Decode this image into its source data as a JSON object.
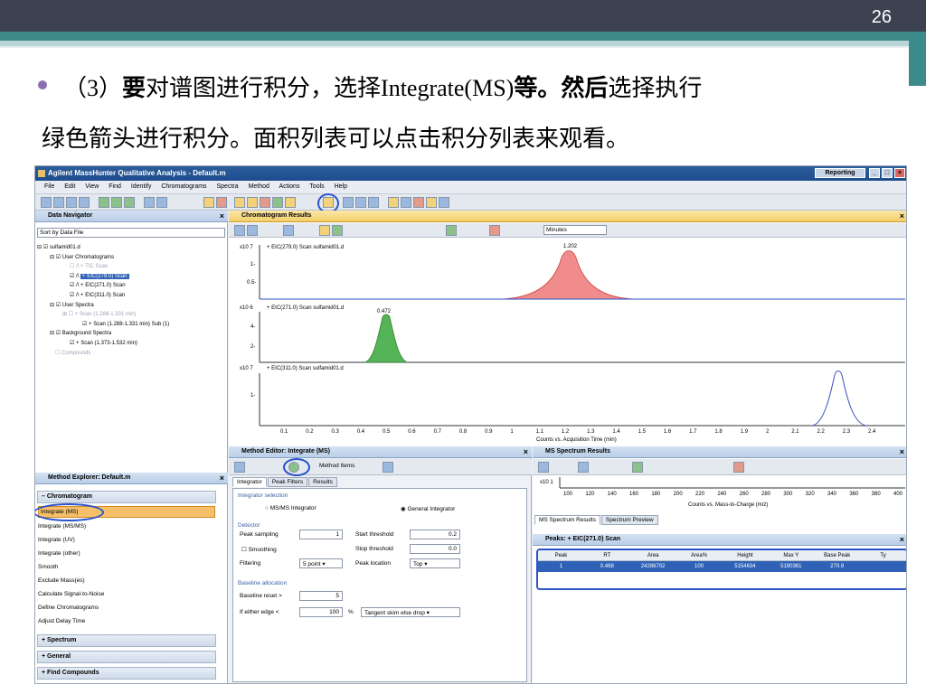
{
  "slide": {
    "number": "26",
    "line1_a": "（3）",
    "line1_b": "要",
    "line1_c": "对谱图进行积分，选择",
    "line1_d": "Integrate(MS)",
    "line1_e": "等。",
    "line1_f": "然后",
    "line1_g": "选择执行",
    "line2": "绿色箭头进行积分。面积列表可以点击积分列表来观看。"
  },
  "app": {
    "title": "Agilent MassHunter Qualitative Analysis - Default.m",
    "layout_btn": "Reporting",
    "menu": [
      "File",
      "Edit",
      "View",
      "Find",
      "Identify",
      "Chromatograms",
      "Spectra",
      "Method",
      "Actions",
      "Tools",
      "Help"
    ]
  },
  "nav": {
    "title": "Data Navigator",
    "sort": "Sort by Data File",
    "tree": [
      "sulfamid01.d",
      "User Chromatograms",
      "+ TIC Scan",
      "+ EIC(279.0) Scan",
      "+ EIC(271.0) Scan",
      "+ EIC(311.0) Scan",
      "User Spectra",
      "+ Scan (1.288-1.331 min)",
      "+ Scan (1.288-1.331 min) Sub (1)",
      "Background Spectra",
      "+ Scan (1.373-1.532 min)",
      "Compounds"
    ]
  },
  "chrom": {
    "title": "Chromatogram Results",
    "units": "Minutes",
    "xlabel": "Counts vs. Acquisition Time (min)",
    "ticks": [
      "0.1",
      "0.2",
      "0.3",
      "0.4",
      "0.5",
      "0.6",
      "0.7",
      "0.8",
      "0.9",
      "1",
      "1.1",
      "1.2",
      "1.3",
      "1.4",
      "1.5",
      "1.6",
      "1.7",
      "1.8",
      "1.9",
      "2",
      "2.1",
      "2.2",
      "2.3",
      "2.4"
    ],
    "plots": [
      {
        "scale": "x10 7",
        "label": "+ EIC(279.0) Scan sulfamid01.d",
        "y": [
          "1-",
          "0.5-"
        ],
        "peak_label": "1.202"
      },
      {
        "scale": "x10 6",
        "label": "+ EIC(271.0) Scan sulfamid01.d",
        "y": [
          "4-",
          "2-"
        ],
        "peak_label": "0.472"
      },
      {
        "scale": "x10 7",
        "label": "+ EIC(311.0) Scan sulfamid01.d",
        "y": [
          "1-"
        ],
        "peak_label": ""
      }
    ]
  },
  "methexp": {
    "title": "Method Explorer: Default.m",
    "section": "Chromatogram",
    "items": [
      "Integrate (MS)",
      "Integrate (MS/MS)",
      "Integrate (UV)",
      "Integrate (other)",
      "Smooth",
      "Exclude Mass(es)",
      "Calculate Signal-to-Noise",
      "Define Chromatograms",
      "Adjust Delay Time"
    ],
    "footer": [
      "Spectrum",
      "General",
      "Find Compounds"
    ]
  },
  "medit": {
    "title": "Method Editor: Integrate (MS)",
    "method_items": "Method Items",
    "tabs": [
      "Integrator",
      "Peak Filters",
      "Results"
    ],
    "integrator_selection": "Integrator selection",
    "msms": "MS/MS Integrator",
    "general": "General Integrator",
    "detector": "Detector",
    "peak_sampling": "Peak sampling",
    "peak_sampling_val": "1",
    "start_threshold": "Start threshold",
    "start_threshold_val": "0.2",
    "smoothing": "Smoothing",
    "stop_threshold": "Stop threshold",
    "stop_threshold_val": "0.0",
    "filtering": "Filtering",
    "filtering_val": "5 point",
    "peak_location": "Peak location",
    "peak_location_val": "Top",
    "baseline_alloc": "Baseline allocation",
    "baseline_reset": "Baseline reset >",
    "baseline_reset_val": "5",
    "if_leading": "If either edge <",
    "if_leading_val": "100",
    "pct": "%",
    "tangent": "Tangent skim else drop"
  },
  "ms": {
    "title": "MS Spectrum Results",
    "scale": "x10 1",
    "xlabel": "Counts vs. Mass-to-Charge (m/z)",
    "ticks": [
      "100",
      "120",
      "140",
      "160",
      "180",
      "200",
      "220",
      "240",
      "260",
      "280",
      "300",
      "320",
      "340",
      "360",
      "380",
      "400"
    ],
    "tab1": "MS Spectrum Results",
    "tab2": "Spectrum Preview"
  },
  "peaks": {
    "title": "Peaks: + EIC(271.0) Scan",
    "headers": [
      "Peak",
      "RT",
      "Area",
      "Area%",
      "Height",
      "Max Y",
      "Base Peak",
      "Ty"
    ],
    "row": [
      "1",
      "0.468",
      "24286702",
      "100",
      "5154634",
      "5190361",
      "270.9",
      ""
    ]
  }
}
